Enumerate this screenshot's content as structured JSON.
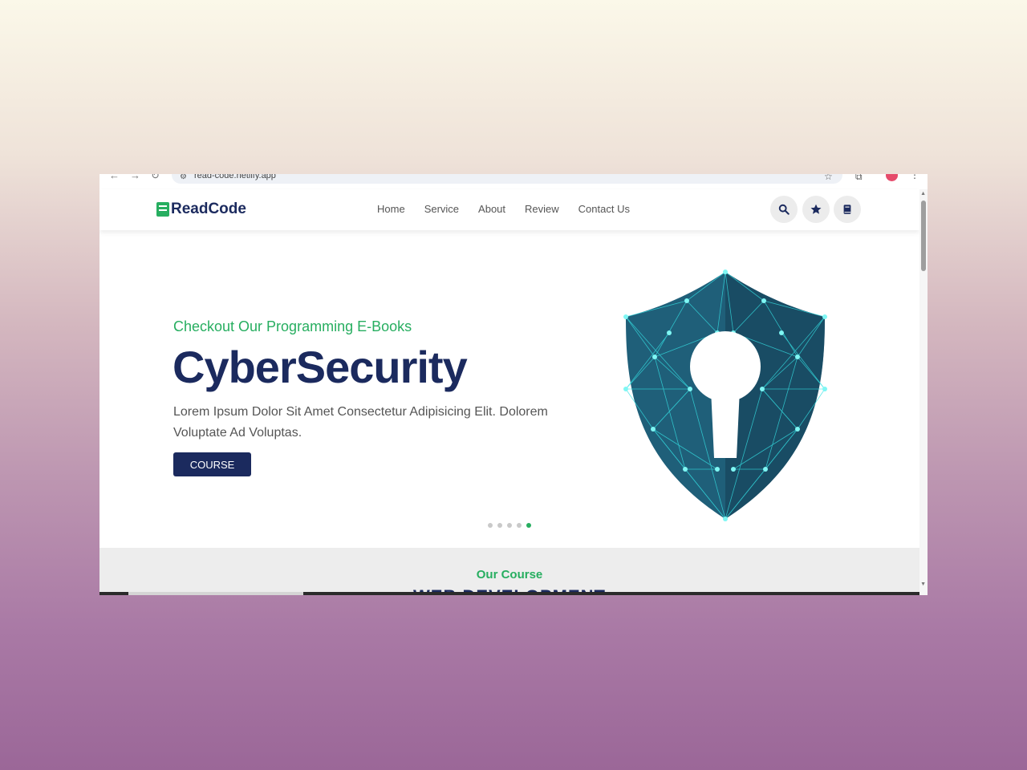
{
  "browser": {
    "url": "read-code.netlify.app",
    "back": "←",
    "forward": "→",
    "reload": "↻",
    "site_info_icon": "tune-icon",
    "bookmark_icon": "☆",
    "extensions_icon": "⧉",
    "menu_icon": "⋮"
  },
  "header": {
    "logo": "ReadCode",
    "nav": [
      "Home",
      "Service",
      "About",
      "Review",
      "Contact Us"
    ],
    "icons": [
      "search-icon",
      "star-icon",
      "book-icon"
    ]
  },
  "hero": {
    "subtitle": "Checkout Our Programming E-Books",
    "title": "CyberSecurity",
    "description": "Lorem Ipsum Dolor Sit Amet Consectetur Adipisicing Elit. Dolorem Voluptate Ad Voluptas.",
    "button": "COURSE",
    "slides_total": 5,
    "active_slide": 5
  },
  "course": {
    "label": "Our Course",
    "heading": "WEB DEVELOPMENT"
  },
  "colors": {
    "primary": "#1b2a5e",
    "accent": "#27ae60",
    "shield": "#1f5f79",
    "shield_lines": "#35e1e4"
  }
}
